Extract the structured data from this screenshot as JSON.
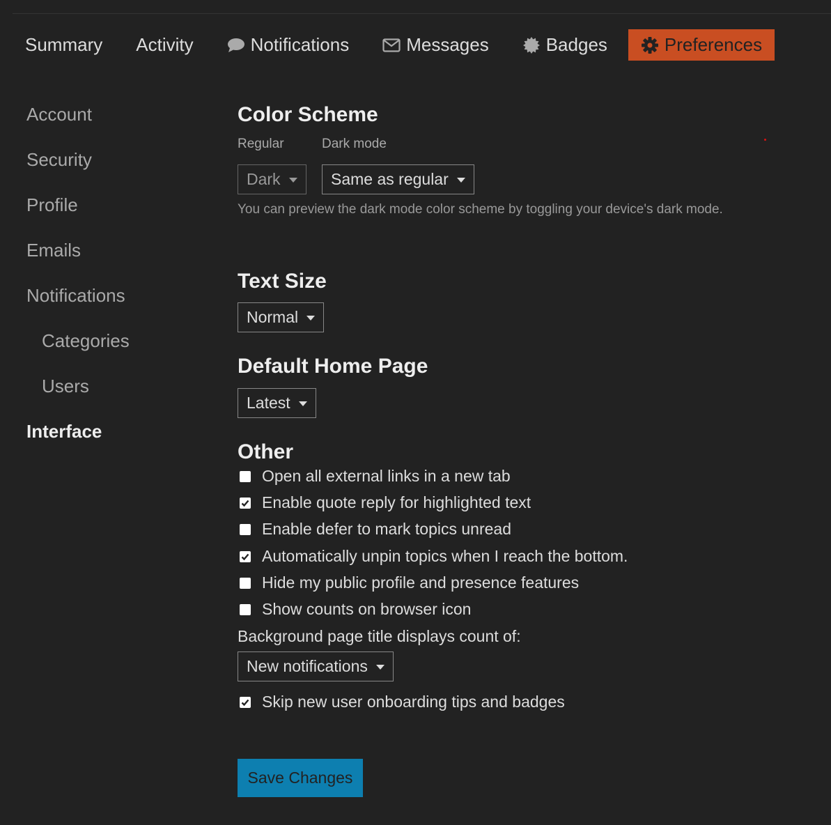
{
  "nav": {
    "tabs": [
      {
        "label": "Summary",
        "icon": ""
      },
      {
        "label": "Activity",
        "icon": ""
      },
      {
        "label": "Notifications",
        "icon": "comment-icon"
      },
      {
        "label": "Messages",
        "icon": "envelope-icon"
      },
      {
        "label": "Badges",
        "icon": "badge-icon"
      },
      {
        "label": "Preferences",
        "icon": "gear-icon",
        "active": true
      }
    ]
  },
  "sidebar": {
    "items": [
      {
        "label": "Account"
      },
      {
        "label": "Security"
      },
      {
        "label": "Profile"
      },
      {
        "label": "Emails"
      },
      {
        "label": "Notifications"
      },
      {
        "label": "Categories",
        "sub": true
      },
      {
        "label": "Users",
        "sub": true
      },
      {
        "label": "Interface",
        "active": true
      }
    ]
  },
  "color_scheme": {
    "title": "Color Scheme",
    "regular_label": "Regular",
    "regular_value": "Dark",
    "dark_mode_label": "Dark mode",
    "dark_mode_value": "Same as regular",
    "hint": "You can preview the dark mode color scheme by toggling your device's dark mode."
  },
  "text_size": {
    "title": "Text Size",
    "value": "Normal"
  },
  "home_page": {
    "title": "Default Home Page",
    "value": "Latest"
  },
  "other": {
    "title": "Other",
    "checks": [
      {
        "label": "Open all external links in a new tab",
        "checked": false
      },
      {
        "label": "Enable quote reply for highlighted text",
        "checked": true
      },
      {
        "label": "Enable defer to mark topics unread",
        "checked": false
      },
      {
        "label": "Automatically unpin topics when I reach the bottom.",
        "checked": true
      },
      {
        "label": "Hide my public profile and presence features",
        "checked": false
      },
      {
        "label": "Show counts on browser icon",
        "checked": false
      }
    ],
    "title_count_label": "Background page title displays count of:",
    "title_count_value": "New notifications",
    "onboarding": {
      "label": "Skip new user onboarding tips and badges",
      "checked": true
    }
  },
  "save_label": "Save Changes",
  "colors": {
    "background": "#222222",
    "accent": "#c94e22",
    "button": "#0d7fb0"
  }
}
